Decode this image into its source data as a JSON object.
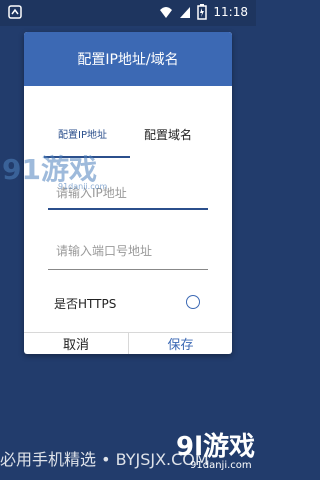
{
  "status": {
    "time": "11:18",
    "icons": [
      "notification-icon",
      "wifi-icon",
      "battery-icon"
    ]
  },
  "dialog": {
    "title": "配置IP地址/域名",
    "tabs": [
      {
        "label": "配置IP地址",
        "active": true
      },
      {
        "label": "配置域名",
        "active": false
      }
    ],
    "fields": {
      "ip_placeholder": "请输入IP地址",
      "port_placeholder": "请输入端口号地址"
    },
    "https_label": "是否HTTPS",
    "cancel_label": "取消",
    "save_label": "保存"
  },
  "overlay": {
    "watermark_top_main": "91游戏",
    "watermark_top_sub": "91danji.com",
    "footer": "必用手机精选 • BYJSJX.COM",
    "watermark_bottom_main": "9l游戏",
    "watermark_bottom_sub": "91danji.com"
  },
  "colors": {
    "background": "#223c6c",
    "header": "#3c69b4",
    "accent": "#2b4f8c"
  }
}
